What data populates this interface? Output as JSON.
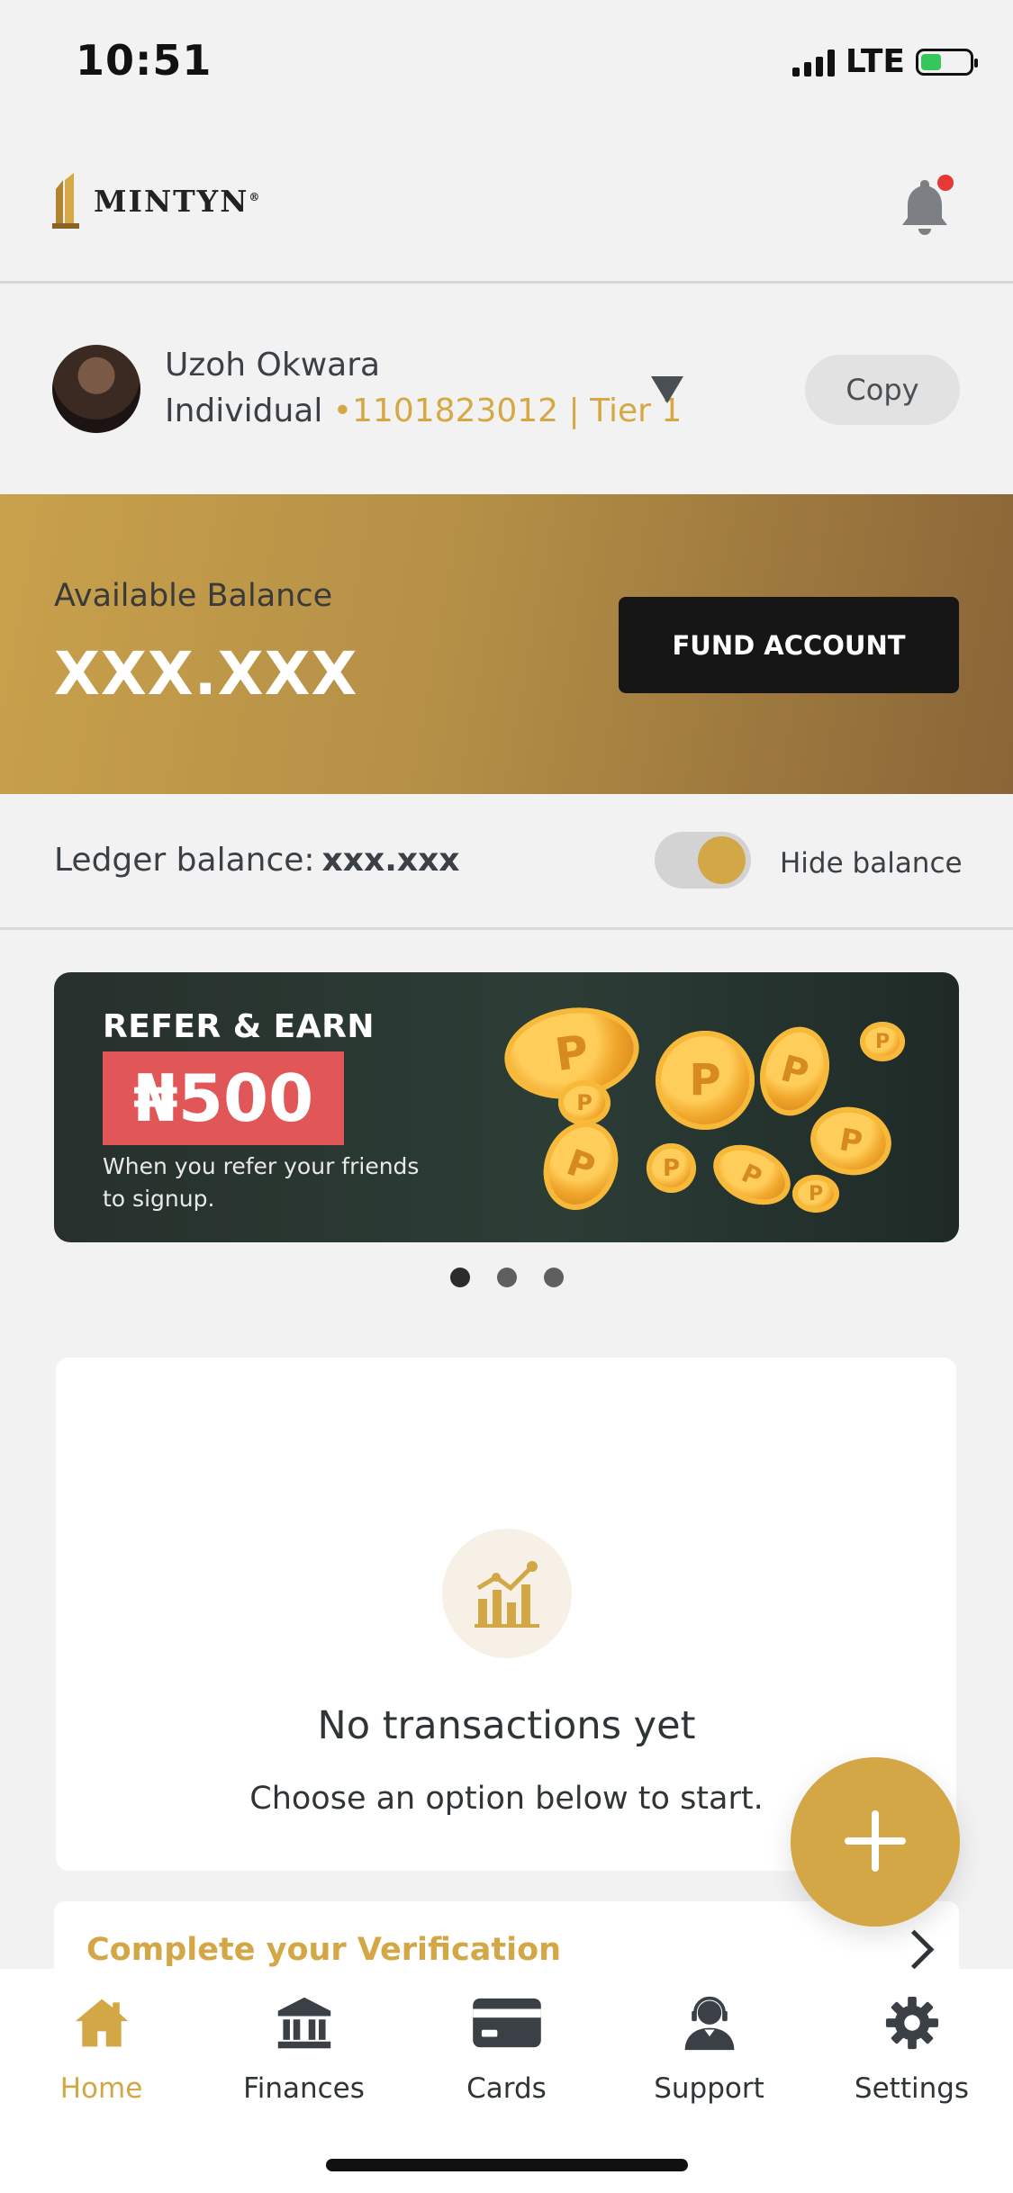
{
  "status_bar": {
    "time": "10:51",
    "network": "LTE"
  },
  "header": {
    "logo_text": "MINTYN",
    "logo_mark": "®"
  },
  "account": {
    "name": "Uzoh Okwara",
    "type": "Individual",
    "bullet": "•",
    "number": "1101823012",
    "tier": "| Tier 1",
    "copy_label": "Copy"
  },
  "balance": {
    "label": "Available Balance",
    "value": "XXX.XXX",
    "fund_label": "FUND ACCOUNT",
    "ledger_label": "Ledger balance:",
    "ledger_value": "xxx.xxx",
    "hide_label": "Hide balance",
    "hide_enabled": true
  },
  "promo": {
    "title": "REFER & EARN",
    "amount": "₦500",
    "subtitle": "When you refer your friends to signup.",
    "slide_count": 3,
    "active_slide": 0
  },
  "transactions": {
    "empty_title": "No transactions yet",
    "empty_subtitle": "Choose an option below to start."
  },
  "verification": {
    "label": "Complete your Verification"
  },
  "tabs": [
    {
      "label": "Home",
      "icon": "home-icon",
      "active": true
    },
    {
      "label": "Finances",
      "icon": "bank-icon",
      "active": false
    },
    {
      "label": "Cards",
      "icon": "card-icon",
      "active": false
    },
    {
      "label": "Support",
      "icon": "support-agent-icon",
      "active": false
    },
    {
      "label": "Settings",
      "icon": "gear-icon",
      "active": false
    }
  ],
  "colors": {
    "accent": "#d3a646",
    "dark": "#161616",
    "promo_red": "#e15656",
    "notification": "#e53935"
  }
}
